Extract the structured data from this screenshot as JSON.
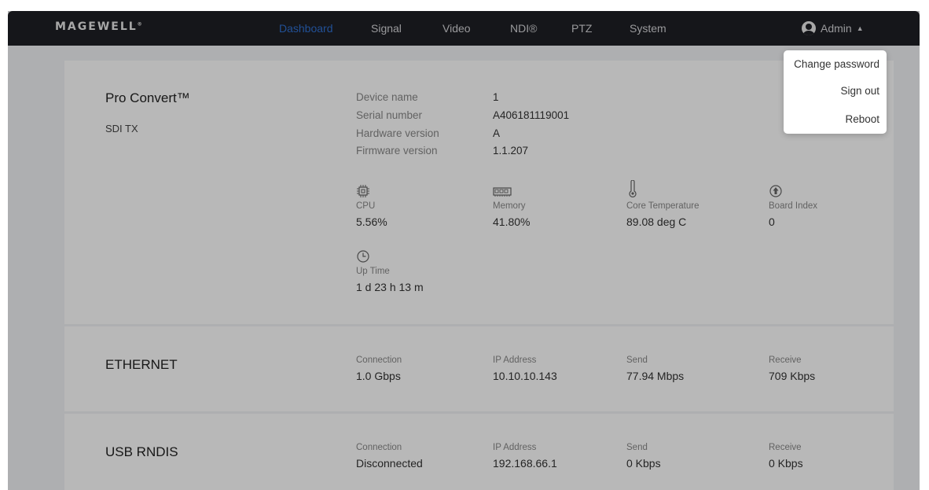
{
  "brand": {
    "logo_text": "MAGEWELL"
  },
  "nav": {
    "items": [
      "Dashboard",
      "Signal",
      "Video",
      "NDI®",
      "PTZ",
      "System"
    ],
    "active": "Dashboard"
  },
  "user": {
    "name": "Admin",
    "menu": [
      "Change password",
      "Sign out",
      "Reboot"
    ]
  },
  "device": {
    "product": "Pro Convert™",
    "model": "SDI TX",
    "info": [
      {
        "label": "Device name",
        "value": "1"
      },
      {
        "label": "Serial number",
        "value": "A406181119001"
      },
      {
        "label": "Hardware version",
        "value": "A"
      },
      {
        "label": "Firmware version",
        "value": "1.1.207"
      }
    ],
    "stats": [
      {
        "icon": "cpu-icon",
        "label": "CPU",
        "value": "5.56%"
      },
      {
        "icon": "memory-icon",
        "label": "Memory",
        "value": "41.80%"
      },
      {
        "icon": "thermometer-icon",
        "label": "Core Temperature",
        "value": "89.08 deg C"
      },
      {
        "icon": "board-index-icon",
        "label": "Board Index",
        "value": "0"
      }
    ],
    "uptime": {
      "icon": "clock-icon",
      "label": "Up Time",
      "value": "1 d 23 h 13 m"
    }
  },
  "ethernet": {
    "title": "ETHERNET",
    "fields": [
      {
        "label": "Connection",
        "value": "1.0 Gbps"
      },
      {
        "label": "IP Address",
        "value": "10.10.10.143"
      },
      {
        "label": "Send",
        "value": "77.94 Mbps"
      },
      {
        "label": "Receive",
        "value": "709 Kbps"
      }
    ]
  },
  "usb": {
    "title": "USB RNDIS",
    "fields": [
      {
        "label": "Connection",
        "value": "Disconnected"
      },
      {
        "label": "IP Address",
        "value": "192.168.66.1"
      },
      {
        "label": "Send",
        "value": "0 Kbps"
      },
      {
        "label": "Receive",
        "value": "0 Kbps"
      }
    ]
  },
  "colors": {
    "topbar": "#1e1f24",
    "accent": "#2f6fd0",
    "background": "#f2f3f5"
  }
}
